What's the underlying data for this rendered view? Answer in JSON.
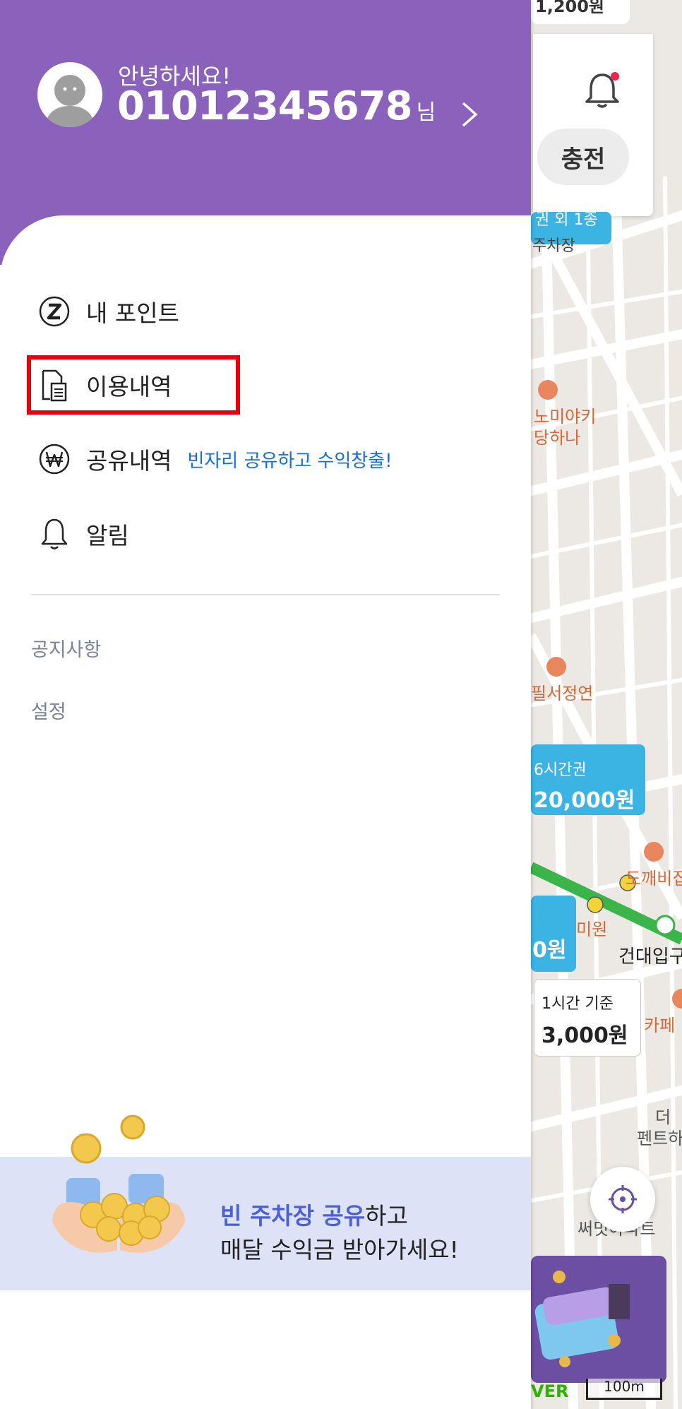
{
  "profile": {
    "greeting": "안녕하세요!",
    "phone": "01012345678",
    "honorific": "님"
  },
  "menu": {
    "points": "내 포인트",
    "usage_history": "이용내역",
    "share_history": "공유내역",
    "share_promo": "빈자리 공유하고 수익창출!",
    "notifications": "알림"
  },
  "sub_menu": {
    "notices": "공지사항",
    "settings": "설정"
  },
  "banner": {
    "highlight": "빈 주차장 공유",
    "line1_rest": "하고",
    "line2": "매달 수익금 받아가세요!"
  },
  "map": {
    "charge_button": "충전",
    "top_price": "1,200원",
    "top_tag_line1": "권 외 1종",
    "top_tag_line2": "주차장",
    "poi_1a": "노미야키",
    "poi_1b": "당하나",
    "poi_2": "필서정연",
    "tag_6h_label": "6시간권",
    "tag_6h_price": "20,000원",
    "tag_left_price": "0원",
    "poi_3": "도깨비집",
    "poi_4": "미원",
    "station": "건대입구",
    "tag_1h_label": "1시간 기준",
    "tag_1h_price": "3,000원",
    "poi_5": "카페",
    "poi_6a": "더",
    "poi_6b": "펜트하",
    "poi_7": "써밋아파트",
    "naver": "VER",
    "scale": "100m"
  },
  "colors": {
    "header": "#8b62bb",
    "promo_text": "#1570d6",
    "highlight_border": "#e8000b",
    "banner_bg": "#dde2f7",
    "banner_accent": "#4a60d8",
    "map_tag": "#3bb4e4"
  }
}
